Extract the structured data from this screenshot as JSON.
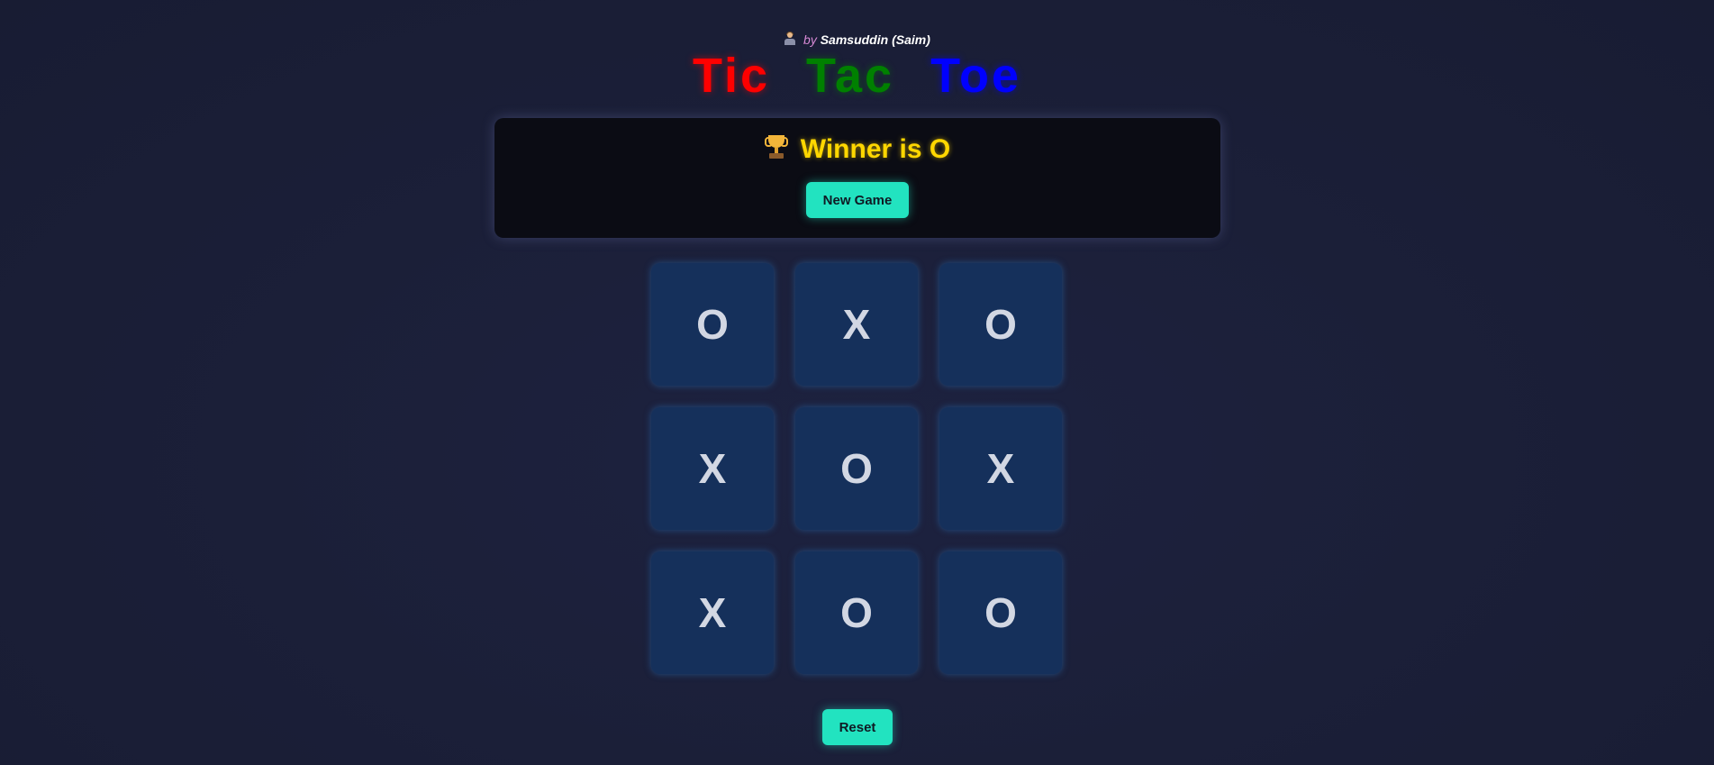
{
  "header": {
    "byline_prefix": "by",
    "author": "Samsuddin (Saim)",
    "title_words": [
      "Tic",
      "Tac",
      "Toe"
    ]
  },
  "status": {
    "message": "Winner is O",
    "new_game_label": "New Game"
  },
  "board": {
    "cells": [
      "O",
      "X",
      "O",
      "X",
      "O",
      "X",
      "X",
      "O",
      "O"
    ]
  },
  "controls": {
    "reset_label": "Reset"
  },
  "colors": {
    "title_tic": "#ff0000",
    "title_tac": "#008000",
    "title_toe": "#0000ff",
    "winner_text": "#ffd700",
    "accent_button": "#22e3c0",
    "cell_background": "#15305b",
    "page_background": "#1b1f38"
  },
  "icons": {
    "byline_icon": "technologist-icon",
    "status_icon": "trophy-icon"
  }
}
